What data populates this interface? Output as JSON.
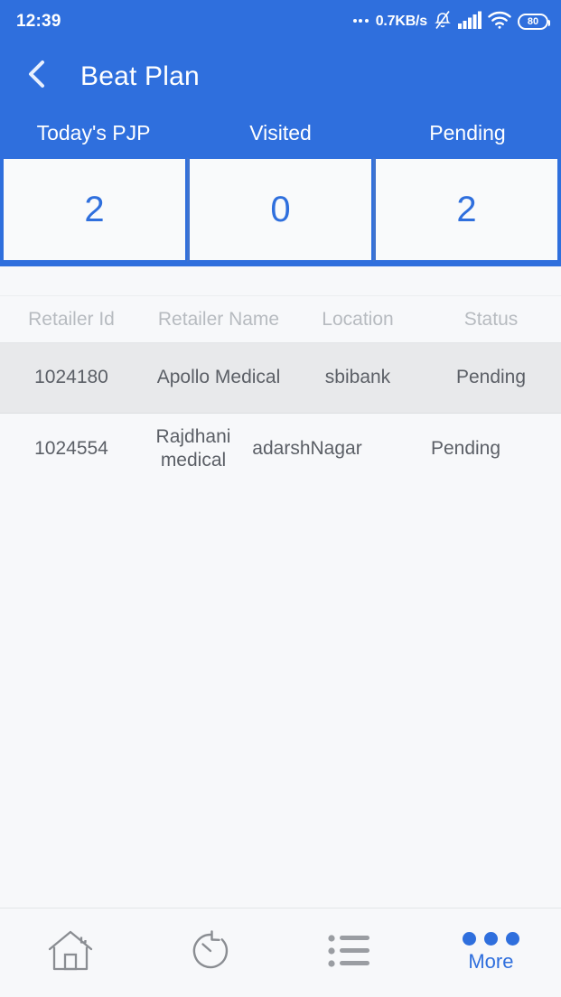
{
  "status_bar": {
    "clock": "12:39",
    "network_speed": "0.7KB/s",
    "battery_level": "80",
    "icons": [
      "notifications-off-icon",
      "signal-icon",
      "wifi-icon",
      "battery-icon"
    ]
  },
  "app_bar": {
    "back_icon": "chevron-left-icon",
    "title": "Beat Plan"
  },
  "stats": {
    "items": [
      {
        "label": "Today's PJP",
        "value": "2"
      },
      {
        "label": "Visited",
        "value": "0"
      },
      {
        "label": "Pending",
        "value": "2"
      }
    ]
  },
  "table": {
    "headers": {
      "retailer_id": "Retailer Id",
      "retailer_name": "Retailer Name",
      "location": "Location",
      "status": "Status"
    },
    "rows": [
      {
        "retailer_id": "1024180",
        "retailer_name": "Apollo Medical",
        "location": "sbibank",
        "status": "Pending"
      },
      {
        "retailer_id": "1024554",
        "retailer_name": "Rajdhani medical",
        "location": "adarshNagar",
        "status": "Pending"
      }
    ]
  },
  "bottom_nav": {
    "items": [
      {
        "icon": "home-icon",
        "label": "",
        "active": false
      },
      {
        "icon": "timer-history-icon",
        "label": "",
        "active": false
      },
      {
        "icon": "list-icon",
        "label": "",
        "active": false
      },
      {
        "icon": "more-dots-icon",
        "label": "More",
        "active": true
      }
    ]
  },
  "colors": {
    "primary_blue": "#2f6fdd",
    "page_bg": "#f7f8fa",
    "row_alt_bg": "#e8e9eb",
    "header_text": "#b7bbc0",
    "cell_text": "#5b5f66"
  }
}
